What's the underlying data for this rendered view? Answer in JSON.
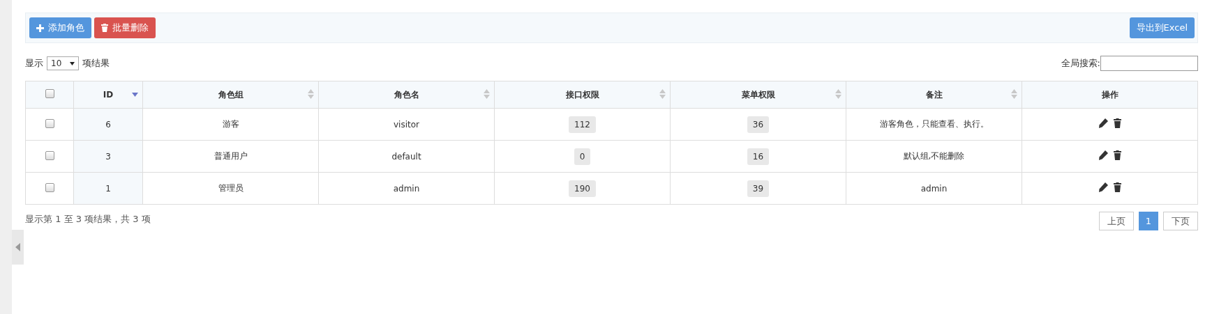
{
  "toolbar": {
    "buttons": [
      {
        "kind": "add",
        "label": "添加角色"
      },
      {
        "kind": "delete",
        "label": "批量删除"
      }
    ],
    "export_button": "导出到Excel"
  },
  "length": {
    "prefix": "显示",
    "value": "10",
    "suffix": "项结果"
  },
  "search": {
    "label": "全局搜索:"
  },
  "table": {
    "select_all_checked": false,
    "columns": [
      {
        "label": "ID",
        "sortable": true,
        "sorted": true
      },
      {
        "label": "角色组",
        "sortable": true,
        "sorted": false
      },
      {
        "label": "角色名",
        "sortable": true,
        "sorted": false
      },
      {
        "label": "接口权限",
        "sortable": true,
        "sorted": false
      },
      {
        "label": "菜单权限",
        "sortable": true,
        "sorted": false
      },
      {
        "label": "备注",
        "sortable": true,
        "sorted": false
      },
      {
        "label": "操作",
        "sortable": false
      }
    ],
    "rows": [
      {
        "checked": false,
        "id": "6",
        "group": "游客",
        "name": "visitor",
        "api": "112",
        "menu": "36",
        "note": "游客角色，只能查看、执行。"
      },
      {
        "checked": false,
        "id": "3",
        "group": "普通用户",
        "name": "default",
        "api": "0",
        "menu": "16",
        "note": "默认组,不能删除"
      },
      {
        "checked": false,
        "id": "1",
        "group": "管理员",
        "name": "admin",
        "api": "190",
        "menu": "39",
        "note": "admin"
      }
    ]
  },
  "info": "显示第 1 至 3 项结果，共 3 项",
  "pagination": {
    "prev": "上页",
    "pages": [
      {
        "label": "1",
        "selected": true
      }
    ],
    "next": "下页"
  }
}
